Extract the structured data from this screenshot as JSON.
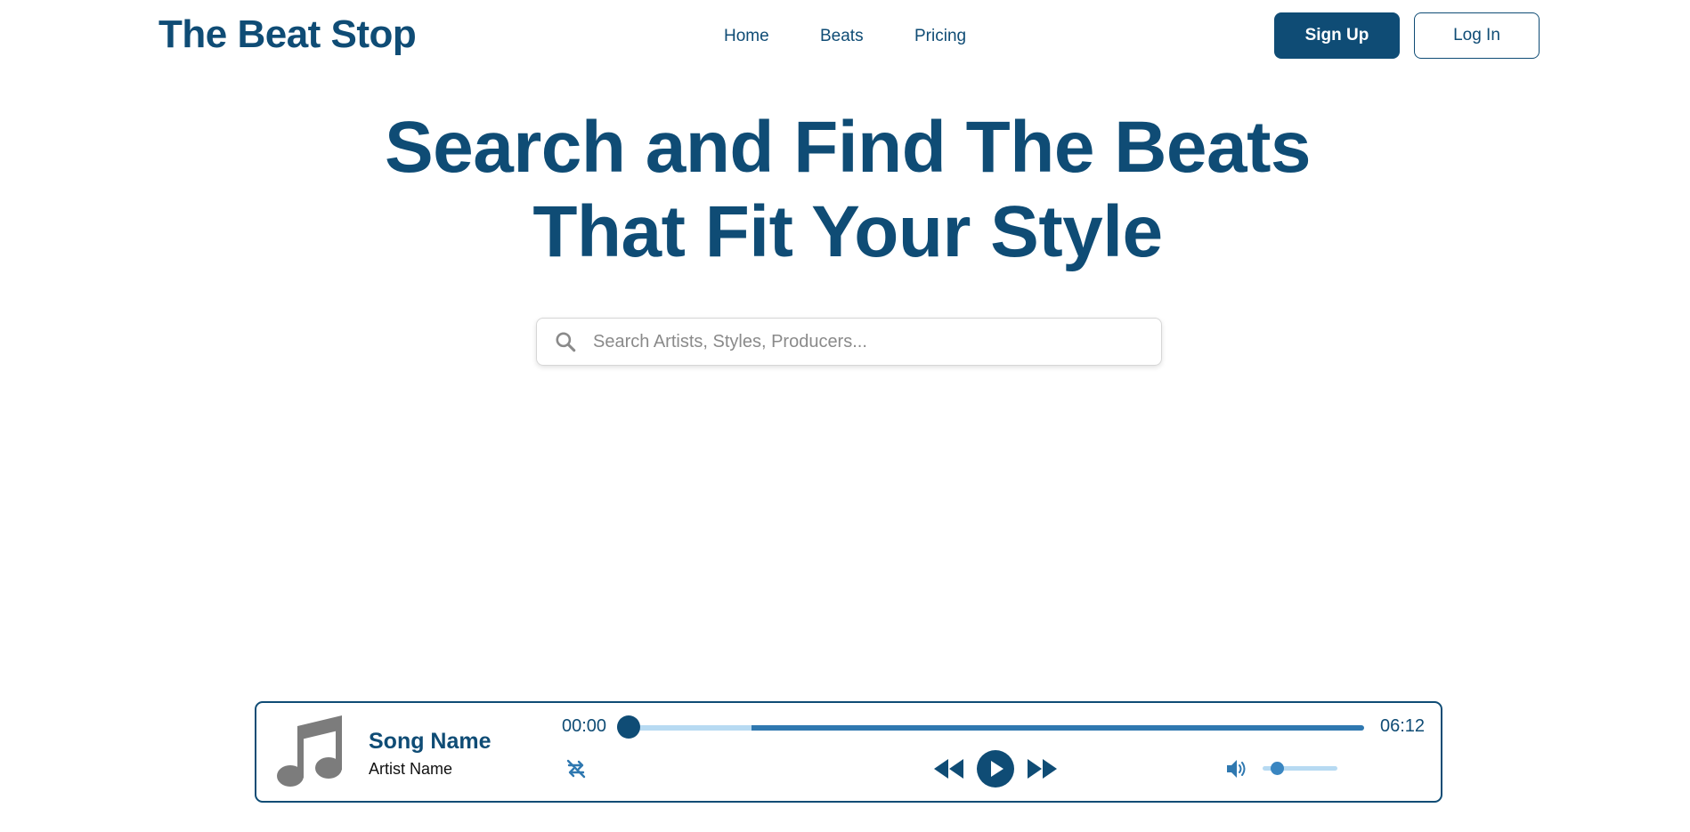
{
  "brand": {
    "logo_text": "The Beat Stop"
  },
  "nav": {
    "items": [
      "Home",
      "Beats",
      "Pricing"
    ]
  },
  "auth": {
    "signup_label": "Sign Up",
    "login_label": "Log In"
  },
  "hero": {
    "line1": "Search and Find The Beats",
    "line2": "That Fit Your Style"
  },
  "search": {
    "placeholder": "Search Artists, Styles, Producers...",
    "value": "",
    "icon": "search-icon"
  },
  "player": {
    "song_name": "Song Name",
    "artist_name": "Artist Name",
    "current_time": "00:00",
    "total_time": "06:12",
    "progress_fraction": 0,
    "buffered_fraction": 0.18,
    "volume_fraction": 0.2,
    "icons": [
      "music-note-icon",
      "repeat-off-icon",
      "rewind-icon",
      "play-icon",
      "fast-forward-icon",
      "volume-icon"
    ]
  },
  "colors": {
    "primary": "#0f4c75",
    "accent": "#2f78b0",
    "light_accent": "#b7daf2"
  }
}
